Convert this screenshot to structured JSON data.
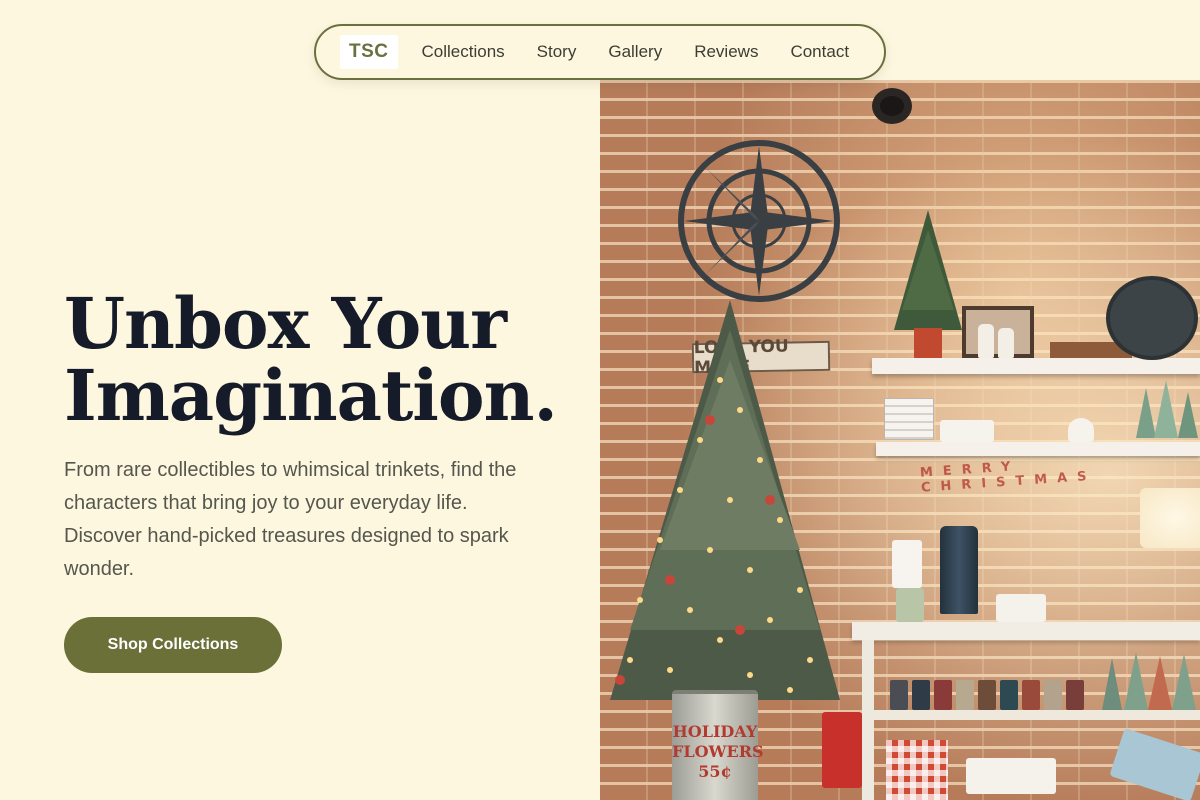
{
  "nav": {
    "logo": "TSC",
    "links": [
      "Collections",
      "Story",
      "Gallery",
      "Reviews",
      "Contact"
    ]
  },
  "hero": {
    "title_line1": "Unbox Your",
    "title_line2": "Imagination.",
    "subtitle": "From rare collectibles to whimsical trinkets, find the characters that bring joy to your everyday life. Discover hand-picked treasures designed to spark wonder.",
    "cta": "Shop Collections"
  },
  "photo": {
    "wall_sign": "LOVE YOU MORE",
    "bucket_text": "HOLIDAY FLOWERS 55¢",
    "banner_letters": "MERRY CHRISTMAS"
  },
  "colors": {
    "background": "#fdf7df",
    "accent": "#6b7039",
    "heading": "#161b2a",
    "body_text": "#55564e"
  }
}
